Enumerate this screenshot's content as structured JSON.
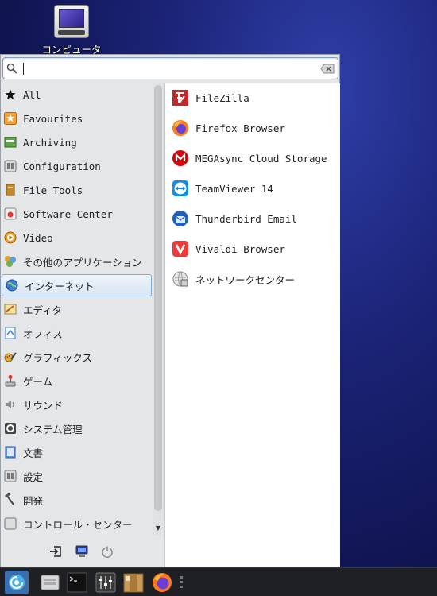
{
  "desktop": {
    "computer_label": "コンピュータ"
  },
  "search": {
    "value": "",
    "placeholder": ""
  },
  "categories": [
    {
      "label": "All",
      "icon": "star-icon"
    },
    {
      "label": "Favourites",
      "icon": "favourites-icon"
    },
    {
      "label": "Archiving",
      "icon": "archive-icon"
    },
    {
      "label": "Configuration",
      "icon": "configuration-icon"
    },
    {
      "label": "File Tools",
      "icon": "file-tools-icon"
    },
    {
      "label": "Software Center",
      "icon": "software-center-icon"
    },
    {
      "label": "Video",
      "icon": "video-icon"
    },
    {
      "label": "その他のアプリケーション",
      "icon": "other-apps-icon"
    },
    {
      "label": "インターネット",
      "icon": "globe-icon",
      "selected": true
    },
    {
      "label": "エディタ",
      "icon": "editor-icon"
    },
    {
      "label": "オフィス",
      "icon": "office-icon"
    },
    {
      "label": "グラフィックス",
      "icon": "graphics-icon"
    },
    {
      "label": "ゲーム",
      "icon": "joystick-icon"
    },
    {
      "label": "サウンド",
      "icon": "speaker-icon"
    },
    {
      "label": "システム管理",
      "icon": "system-icon"
    },
    {
      "label": "文書",
      "icon": "document-icon"
    },
    {
      "label": "設定",
      "icon": "settings-icon"
    },
    {
      "label": "開発",
      "icon": "hammer-icon"
    },
    {
      "label": "コントロール・センター",
      "icon": "control-center-icon"
    }
  ],
  "apps": [
    {
      "label": "FileZilla",
      "icon": "filezilla-icon"
    },
    {
      "label": "Firefox Browser",
      "icon": "firefox-icon"
    },
    {
      "label": "MEGAsync Cloud Storage",
      "icon": "mega-icon"
    },
    {
      "label": "TeamViewer 14",
      "icon": "teamviewer-icon"
    },
    {
      "label": "Thunderbird Email",
      "icon": "thunderbird-icon"
    },
    {
      "label": "Vivaldi Browser",
      "icon": "vivaldi-icon"
    },
    {
      "label": "ネットワークセンター",
      "icon": "network-center-icon"
    }
  ],
  "colors": {
    "selection_border": "#88a9cc",
    "taskbar_bg": "#1f2024",
    "taskbar_active": "#3a6fb0"
  }
}
